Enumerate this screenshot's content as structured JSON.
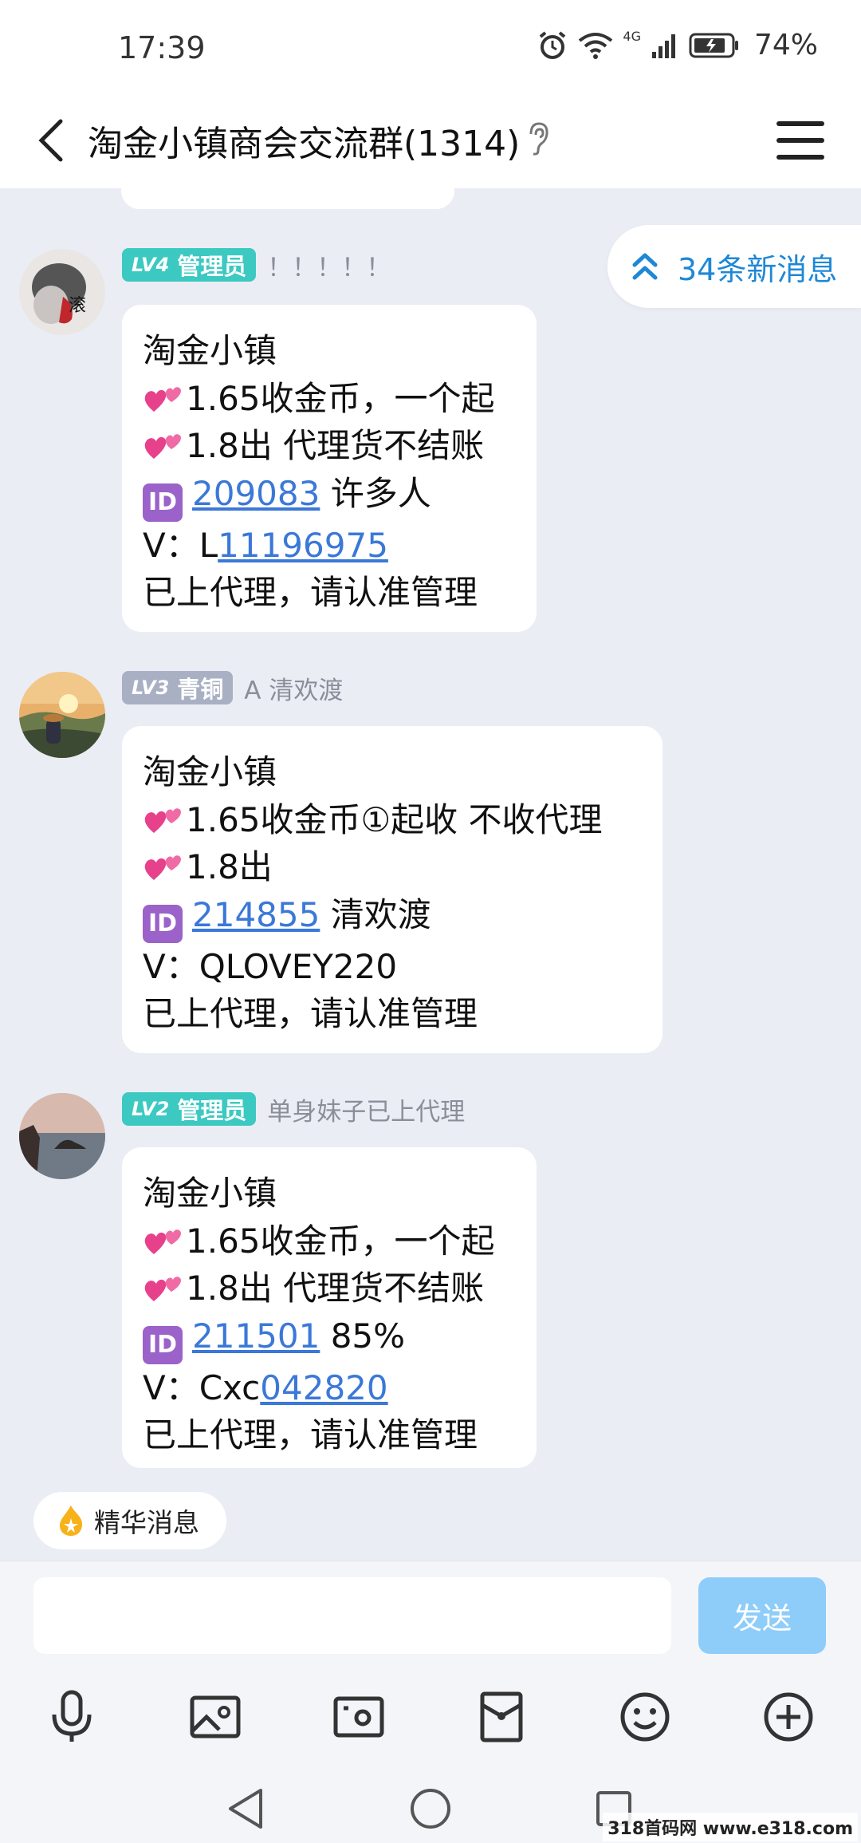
{
  "status_bar": {
    "time": "17:39",
    "network": "4G",
    "battery": "74%"
  },
  "header": {
    "title": "淘金小镇商会交流群(1314)"
  },
  "new_messages": {
    "label": "34条新消息"
  },
  "messages": [
    {
      "level": "LV4",
      "role": "管理员",
      "nickname": "！！！！！",
      "badge_color": "#3cc9c1",
      "lines": {
        "l1": "淘金小镇",
        "l2": "1.65收金币，一个起",
        "l3": "1.8出 代理货不结账",
        "l4_id": "209083",
        "l4_rest": " 许多人",
        "l5_prefix": "V：L",
        "l5_link": "11196975",
        "l6": " 已上代理，请认准管理"
      }
    },
    {
      "level": "LV3",
      "role": "青铜",
      "nickname": "A  清欢渡",
      "badge_color": "#a9b0c4",
      "lines": {
        "l1": "淘金小镇",
        "l2": "1.65收金币①起收  不收代理",
        "l3": "1.8出",
        "l4_id": "214855",
        "l4_rest": "   清欢渡",
        "l5": "V：QLOVEY220",
        "l6": "已上代理，请认准管理"
      }
    },
    {
      "level": "LV2",
      "role": "管理员",
      "nickname": "单身妹子已上代理",
      "badge_color": "#3cc9c1",
      "lines": {
        "l1": "淘金小镇",
        "l2": "1.65收金币，一个起",
        "l3": "1.8出 代理货不结账",
        "l4_id": "211501",
        "l4_rest": "  85%",
        "l5_prefix": "V：Cxc",
        "l5_link": "042820",
        "l6": " 已上代理，请认准管理"
      }
    }
  ],
  "id_icon_label": "ID",
  "essence": {
    "label": "精华消息"
  },
  "composer": {
    "placeholder": "",
    "send_label": "发送"
  },
  "toolbar_icons": [
    "microphone-icon",
    "image-icon",
    "camera-icon",
    "red-packet-icon",
    "emoji-icon",
    "plus-icon"
  ],
  "nav_icons": [
    "back-triangle-icon",
    "home-circle-icon",
    "recents-square-icon"
  ],
  "watermark": "318首码网 www.e318.com",
  "colors": {
    "link": "#3b78d8",
    "send_button": "#8ecdf9",
    "accent_blue": "#1e88d6",
    "chat_bg": "#ebedf5"
  }
}
